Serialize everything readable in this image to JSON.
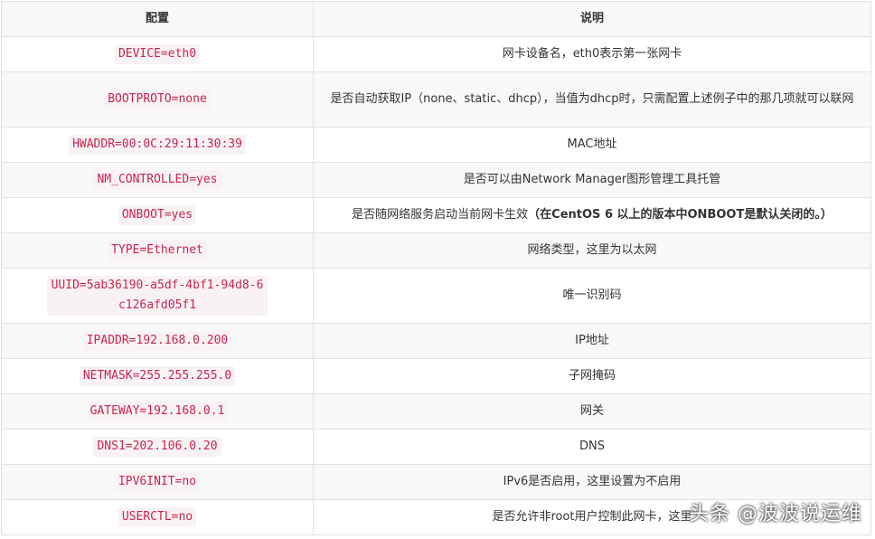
{
  "table": {
    "headers": [
      "配置",
      "说明"
    ],
    "rows": [
      {
        "key": "DEVICE=eth0",
        "desc": "网卡设备名，eth0表示第一张网卡"
      },
      {
        "key": "BOOTPROTO=none",
        "desc": "是否自动获取IP（none、static、dhcp），当值为dhcp时，只需配置上述例子中的那几项就可以联网"
      },
      {
        "key": "HWADDR=00:0C:29:11:30:39",
        "desc": "MAC地址"
      },
      {
        "key": "NM_CONTROLLED=yes",
        "desc": "是否可以由Network Manager图形管理工具托管"
      },
      {
        "key": "ONBOOT=yes",
        "desc": "是否随网络服务启动当前网卡生效",
        "desc_bold": "（在CentOS 6 以上的版本中ONBOOT是默认关闭的。）"
      },
      {
        "key": "TYPE=Ethernet",
        "desc": "网络类型，这里为以太网"
      },
      {
        "key": "UUID=5ab36190-a5df-4bf1-94d8-6c126afd05f1",
        "desc": "唯一识别码"
      },
      {
        "key": "IPADDR=192.168.0.200",
        "desc": "IP地址"
      },
      {
        "key": "NETMASK=255.255.255.0",
        "desc": "子网掩码"
      },
      {
        "key": "GATEWAY=192.168.0.1",
        "desc": "网关"
      },
      {
        "key": "DNS1=202.106.0.20",
        "desc": "DNS"
      },
      {
        "key": "IPV6INIT=no",
        "desc": "IPv6是否启用，这里设置为不启用"
      },
      {
        "key": "USERCTL=no",
        "desc": "是否允许非root用户控制此网卡，这里"
      }
    ]
  },
  "watermark": "头条 @波波说运维"
}
